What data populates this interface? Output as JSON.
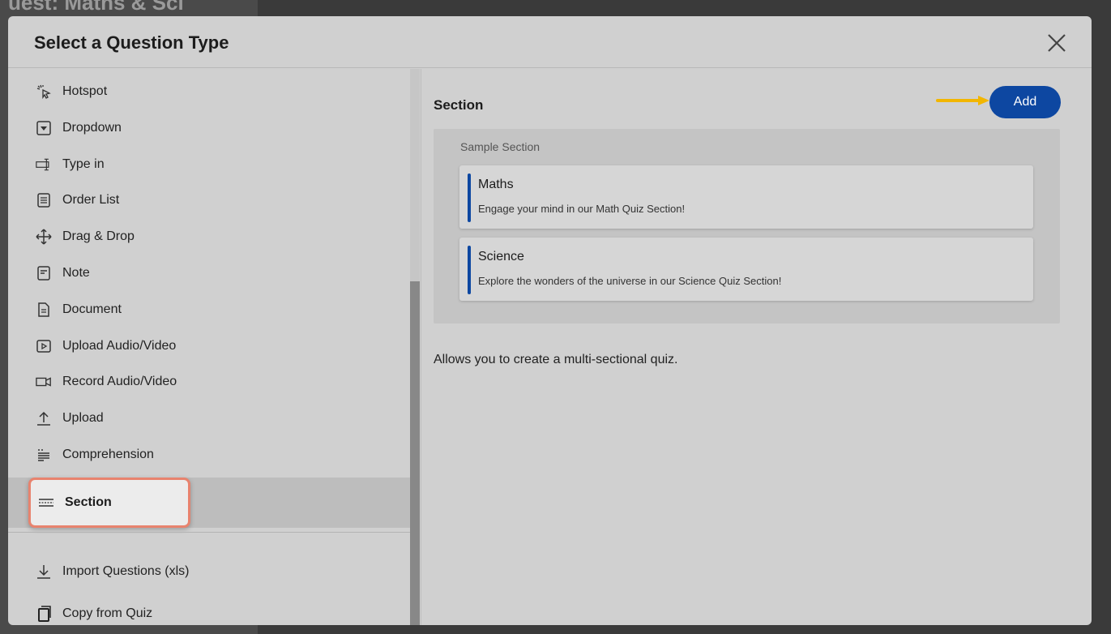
{
  "background": {
    "title": "uest: Maths & Sci"
  },
  "dialog": {
    "title": "Select a Question Type",
    "close_icon": "close-icon"
  },
  "question_types": [
    {
      "label": "Hotspot",
      "icon": "hotspot-icon"
    },
    {
      "label": "Dropdown",
      "icon": "dropdown-icon"
    },
    {
      "label": "Type in",
      "icon": "type-in-icon"
    },
    {
      "label": "Order List",
      "icon": "order-list-icon"
    },
    {
      "label": "Drag & Drop",
      "icon": "drag-drop-icon"
    },
    {
      "label": "Note",
      "icon": "note-icon"
    },
    {
      "label": "Document",
      "icon": "document-icon"
    },
    {
      "label": "Upload Audio/Video",
      "icon": "upload-video-icon"
    },
    {
      "label": "Record Audio/Video",
      "icon": "record-video-icon"
    },
    {
      "label": "Upload",
      "icon": "upload-icon"
    },
    {
      "label": "Comprehension",
      "icon": "comprehension-icon"
    }
  ],
  "selected_type": {
    "label": "Section",
    "icon": "section-icon"
  },
  "extra_actions": [
    {
      "label": "Import Questions (xls)",
      "icon": "import-icon"
    },
    {
      "label": "Copy from Quiz",
      "icon": "copy-icon"
    }
  ],
  "preview": {
    "title": "Section",
    "add_label": "Add",
    "sample_label": "Sample Section",
    "cards": [
      {
        "title": "Maths",
        "desc": "Engage your mind in our Math Quiz Section!"
      },
      {
        "title": "Science",
        "desc": "Explore the wonders of the universe in our Science Quiz Section!"
      }
    ],
    "description": "Allows you to create a multi-sectional quiz."
  },
  "colors": {
    "accent": "#0d47a1",
    "highlight_border": "#e8836e",
    "arrow": "#f2b600"
  }
}
